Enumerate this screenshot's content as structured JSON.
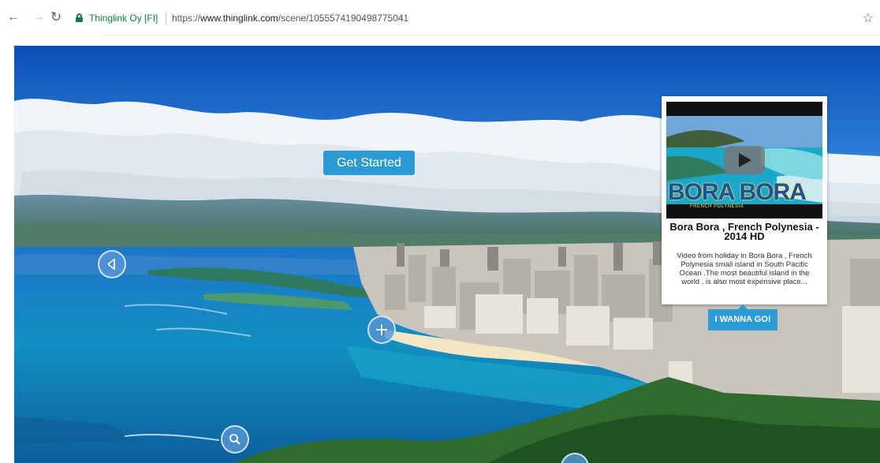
{
  "browser": {
    "site_name": "Thinglink Oy [FI]",
    "url_scheme": "https://",
    "url_host": "www.thinglink.com",
    "url_path": "/scene/1055574190498775041",
    "icons": [
      "back-arrow-icon",
      "forward-arrow-icon",
      "reload-icon",
      "lock-icon",
      "star-icon"
    ],
    "secure_color": "#0b8043"
  },
  "scene": {
    "get_started_label": "Get Started",
    "accent_color": "#2b9ad3",
    "hotspot_icons": [
      "audio-hotspot-icon",
      "plus-hotspot-icon",
      "search-hotspot-icon",
      "hotspot-icon"
    ]
  },
  "popup": {
    "video_title": "BORA BORA",
    "video_subtitle": "FRENCH POLYNESIA",
    "title": "Bora Bora , French Polynesia - 2014 HD",
    "description": "Video from holiday in Bora Bora , French Polynesia small island in South Pacific Ocean .The most beautiful island in the world , is also most expensive place...",
    "cta_label": "I WANNA GO!"
  }
}
